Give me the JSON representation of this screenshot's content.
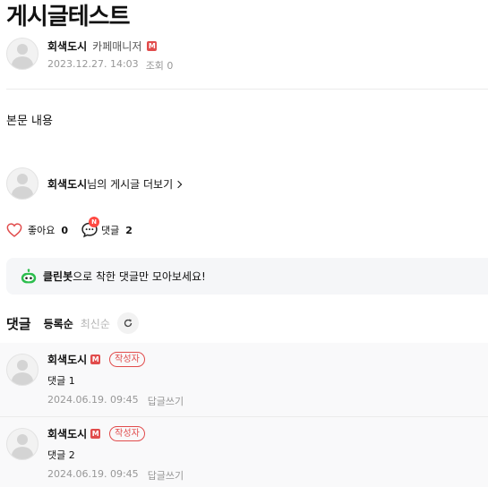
{
  "post": {
    "title": "게시글테스트",
    "author": "회색도시",
    "grade": "카페매니저",
    "manager_badge": "M",
    "date": "2023.12.27. 14:03",
    "views": "조회 0",
    "body": "본문 내용"
  },
  "more": {
    "author": "회색도시",
    "suffix": "님의 게시글 더보기"
  },
  "reactions": {
    "like_label": "좋아요",
    "like_count": "0",
    "comment_label": "댓글",
    "comment_count": "2",
    "new_badge": "N"
  },
  "banner": {
    "bold": "클린봇",
    "text": "으로 착한 댓글만 모아보세요!"
  },
  "comments_section": {
    "heading": "댓글",
    "sort_registered": "등록순",
    "sort_latest": "최신순"
  },
  "comments": [
    {
      "author": "회색도시",
      "badge": "M",
      "writer_tag": "작성자",
      "text": "댓글 1",
      "date": "2024.06.19. 09:45",
      "reply": "답글쓰기"
    },
    {
      "author": "회색도시",
      "badge": "M",
      "writer_tag": "작성자",
      "text": "댓글 2",
      "date": "2024.06.19. 09:45",
      "reply": "답글쓰기"
    }
  ],
  "colors": {
    "accent_red": "#e14c4c",
    "clean_bot_green": "#2dbe4e",
    "banner_bg": "#f5f6f8"
  }
}
